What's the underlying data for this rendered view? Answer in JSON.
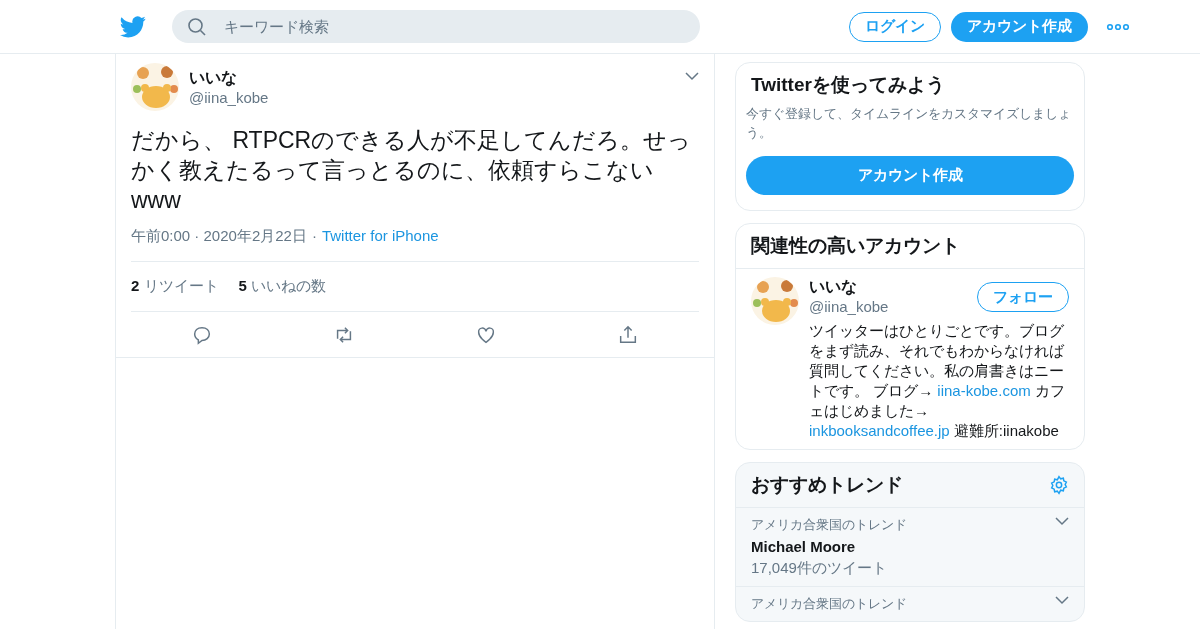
{
  "header": {
    "search": {
      "placeholder": "キーワード検索"
    },
    "login": "ログイン",
    "signup": "アカウント作成"
  },
  "tweet": {
    "name": "いいな",
    "handle": "@iina_kobe",
    "text": "だから、 RTPCRのできる人が不足してんだろ。せっかく教えたるって言っとるのに、依頼すらこない www",
    "time": "午前0:00 · 2020年2月22日",
    "separator": "·",
    "source": "Twitter for iPhone",
    "stats": [
      {
        "count": "2",
        "label": "リツイート"
      },
      {
        "count": "5",
        "label": "いいねの数"
      }
    ]
  },
  "signup_card": {
    "title": "Twitterを使ってみよう",
    "text": "今すぐ登録して、タイムラインをカスタマイズしましょう。",
    "button": "アカウント作成"
  },
  "related": {
    "title": "関連性の高いアカウント",
    "accounts": [
      {
        "name": "いいな",
        "handle": "@iina_kobe",
        "follow": "フォロー",
        "bio": [
          {
            "kind": "text",
            "text": "ツイッターはひとりごとです。ブログをまず読み、それでもわからなければ質問してください。私の肩書きはニートです。 ブログ→ "
          },
          {
            "kind": "link",
            "text": "iina-kobe.com"
          },
          {
            "kind": "text",
            "text": " カフェはじめました→ "
          },
          {
            "kind": "link",
            "text": "inkbooksandcoffee.jp"
          },
          {
            "kind": "text",
            "text": " 避難所:iinakobe"
          }
        ]
      }
    ]
  },
  "trends": {
    "title": "おすすめトレンド",
    "items": [
      {
        "context": "アメリカ合衆国のトレンド",
        "name": "Michael Moore",
        "count": "17,049件のツイート"
      },
      {
        "context": "アメリカ合衆国のトレンド"
      }
    ]
  }
}
